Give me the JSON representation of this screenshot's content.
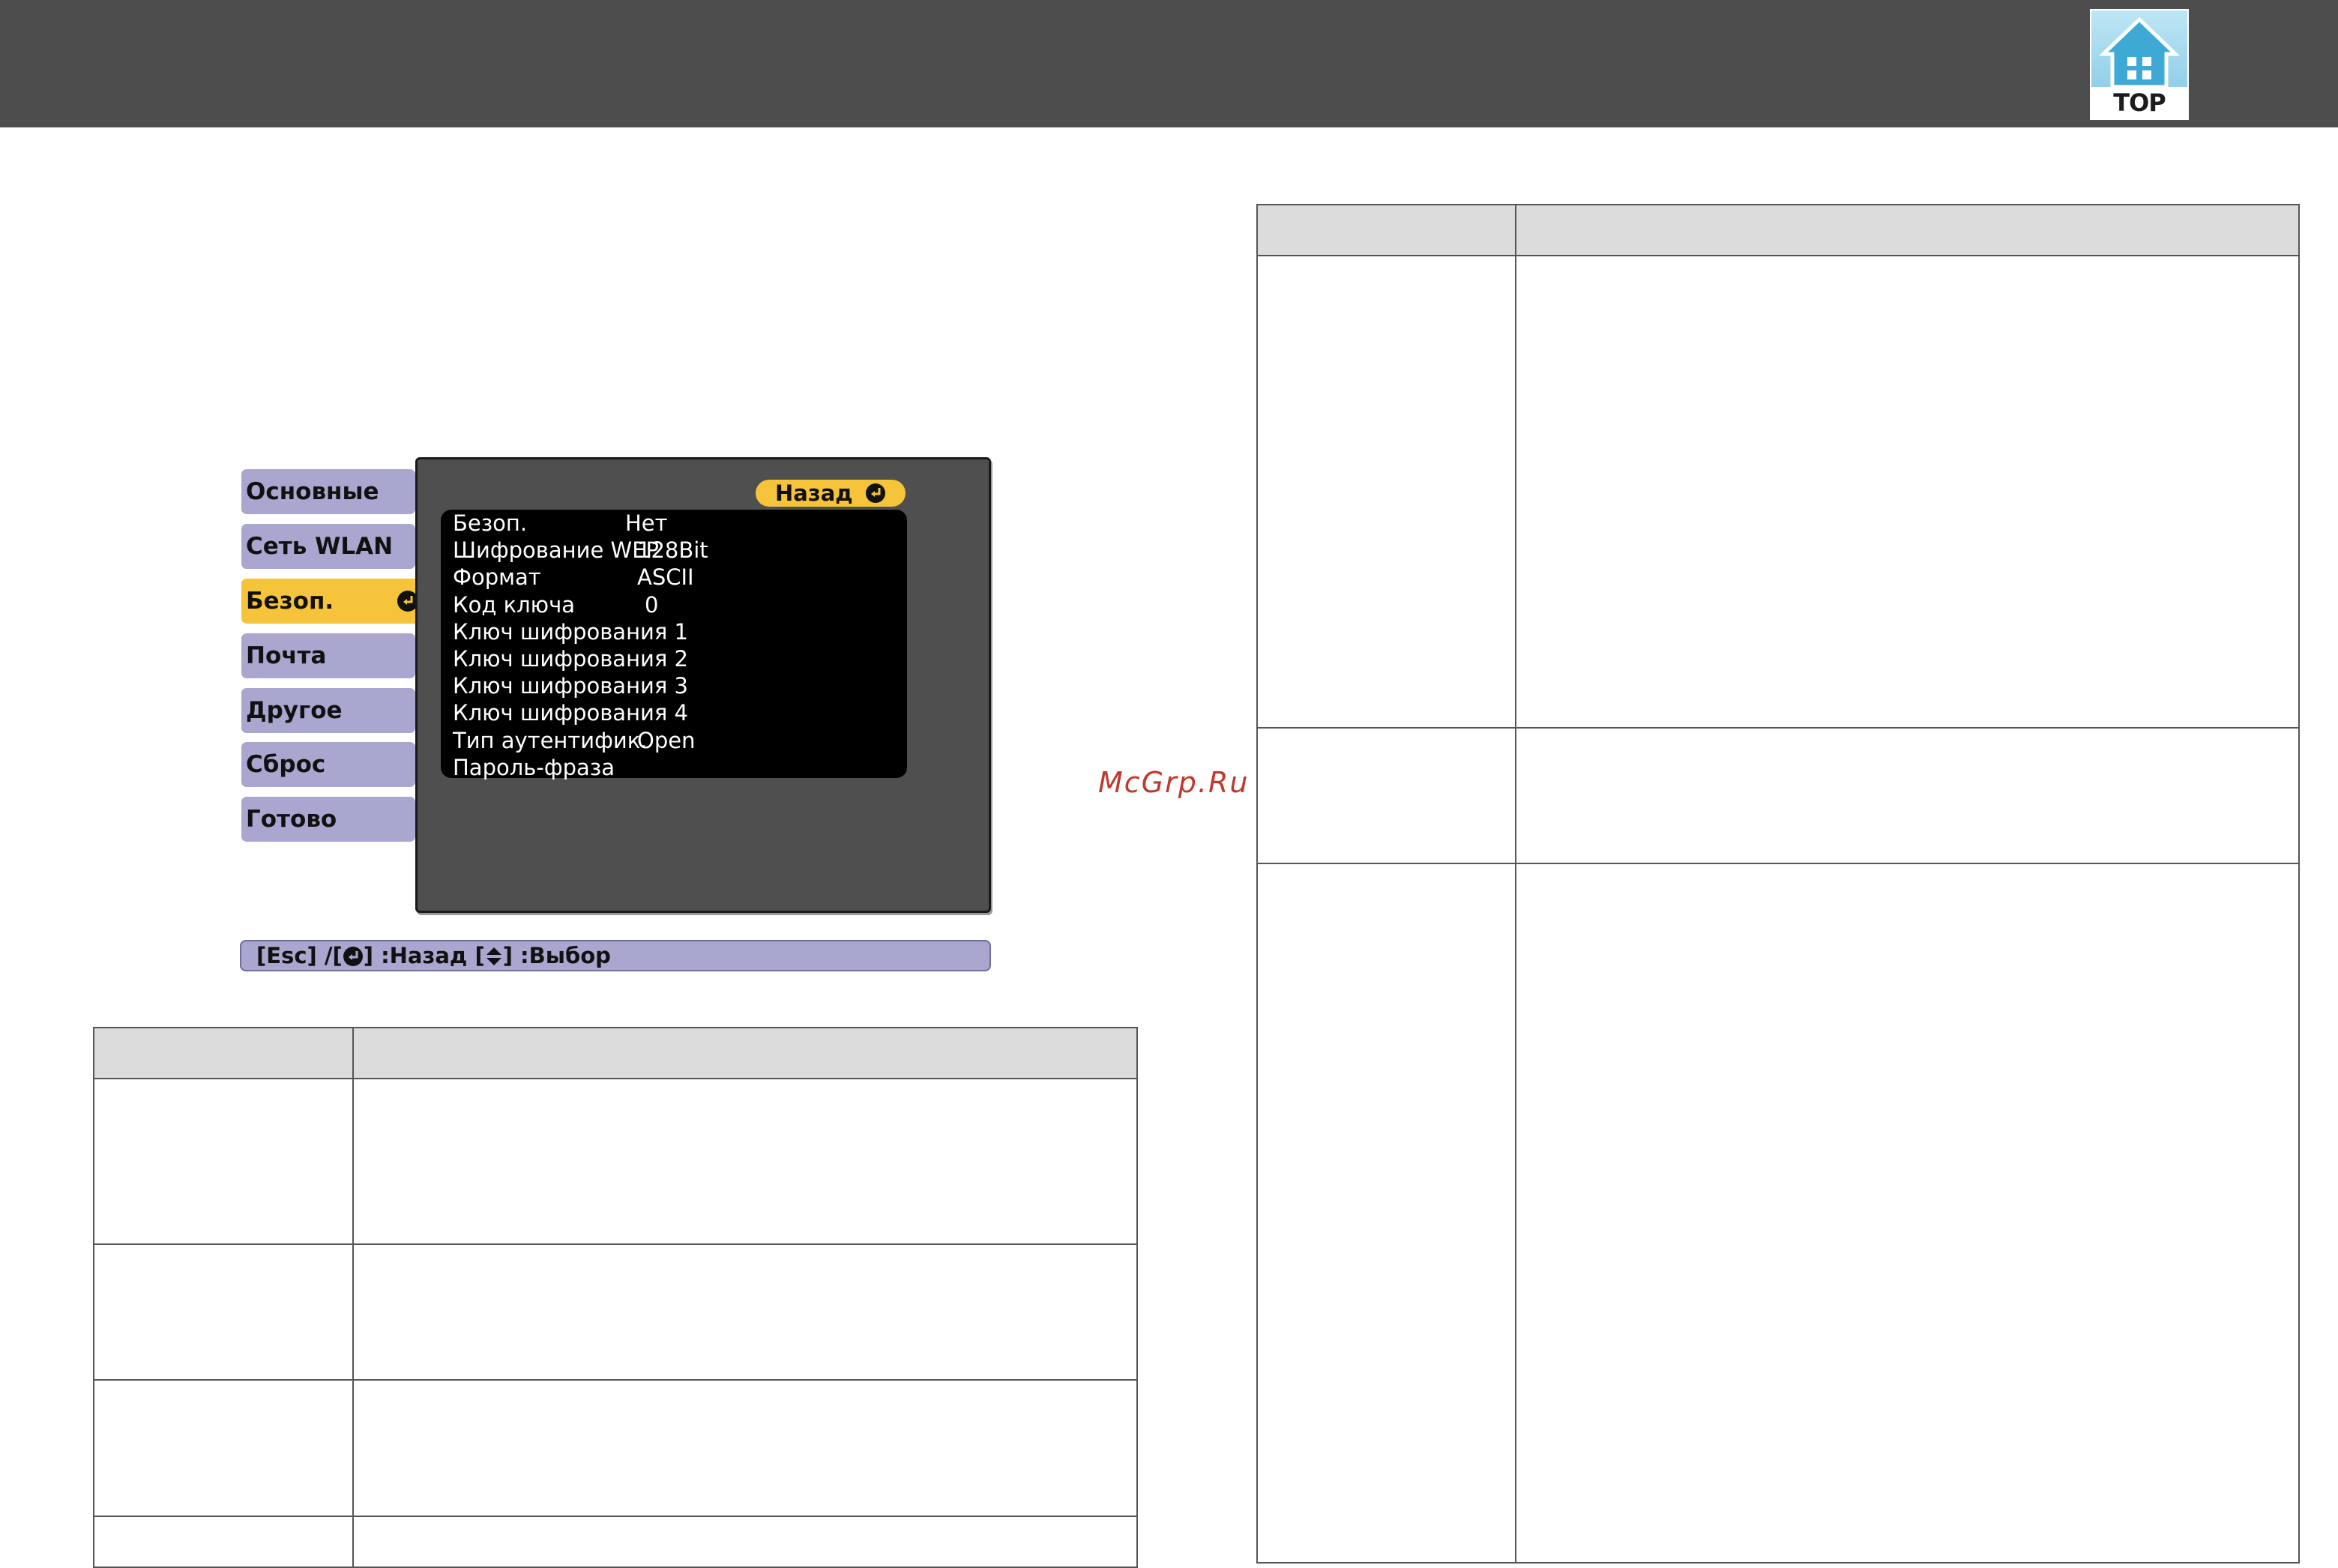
{
  "header": {
    "logo_label": "TOP"
  },
  "menu": {
    "tabs": [
      {
        "label": "Основные",
        "active": false
      },
      {
        "label": "Сеть WLAN",
        "active": false
      },
      {
        "label": "Безоп.",
        "active": true
      },
      {
        "label": "Почта",
        "active": false
      },
      {
        "label": "Другое",
        "active": false
      },
      {
        "label": "Сброс",
        "active": false
      },
      {
        "label": "Готово",
        "active": false
      }
    ],
    "back_label": "Назад",
    "rows": [
      {
        "name": "Безоп.",
        "value": "Нет"
      },
      {
        "name": "Шифрование WEP",
        "value": "128Bit"
      },
      {
        "name": "Формат",
        "value": "ASCII"
      },
      {
        "name": "Код ключа",
        "value": "0"
      },
      {
        "name": "Ключ шифрования 1",
        "value": ""
      },
      {
        "name": "Ключ шифрования 2",
        "value": ""
      },
      {
        "name": "Ключ шифрования 3",
        "value": ""
      },
      {
        "name": "Ключ шифрования 4",
        "value": ""
      },
      {
        "name": "Тип аутентифик.",
        "value": "Open"
      },
      {
        "name": "Пароль-фраза",
        "value": ""
      }
    ],
    "footer": {
      "esc": "[Esc] /[",
      "back": "] :Назад  [",
      "select": "] :Выбор"
    }
  },
  "watermark": "McGrp.Ru",
  "colors": {
    "accent": "#f6c43a",
    "tab": "#a9a6cf",
    "panel": "#4f4f4f",
    "header": "#4d4d4d"
  }
}
